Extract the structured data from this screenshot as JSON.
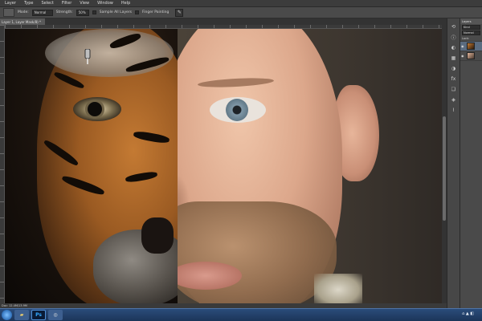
{
  "menu": [
    "Layer",
    "Type",
    "Select",
    "Filter",
    "View",
    "Window",
    "Help"
  ],
  "options": {
    "mode_label": "Mode:",
    "mode_value": "Normal",
    "strength_label": "Strength:",
    "strength_value": "50%",
    "sample_all_label": "Sample All Layers",
    "finger_painting_label": "Finger Painting"
  },
  "document": {
    "tab_title": "Layer 1, Layer Mask/8) *"
  },
  "status": {
    "text": "Doc: 12.4M/13.9M"
  },
  "layers_panel": {
    "tab_label": "Layers",
    "kind_label": "Kind",
    "blend_mode": "Normal",
    "lock_label": "Lock:"
  },
  "right_icons": [
    "history-icon",
    "info-icon",
    "color-icon",
    "swatches-icon",
    "adjust-icon",
    "styles-icon",
    "layers-icon",
    "channels-icon",
    "paths-icon"
  ],
  "colors": {
    "ps_blue": "#33a8ff",
    "taskbar": "#2a4c7a",
    "panel_bg": "#4a4a4a"
  }
}
